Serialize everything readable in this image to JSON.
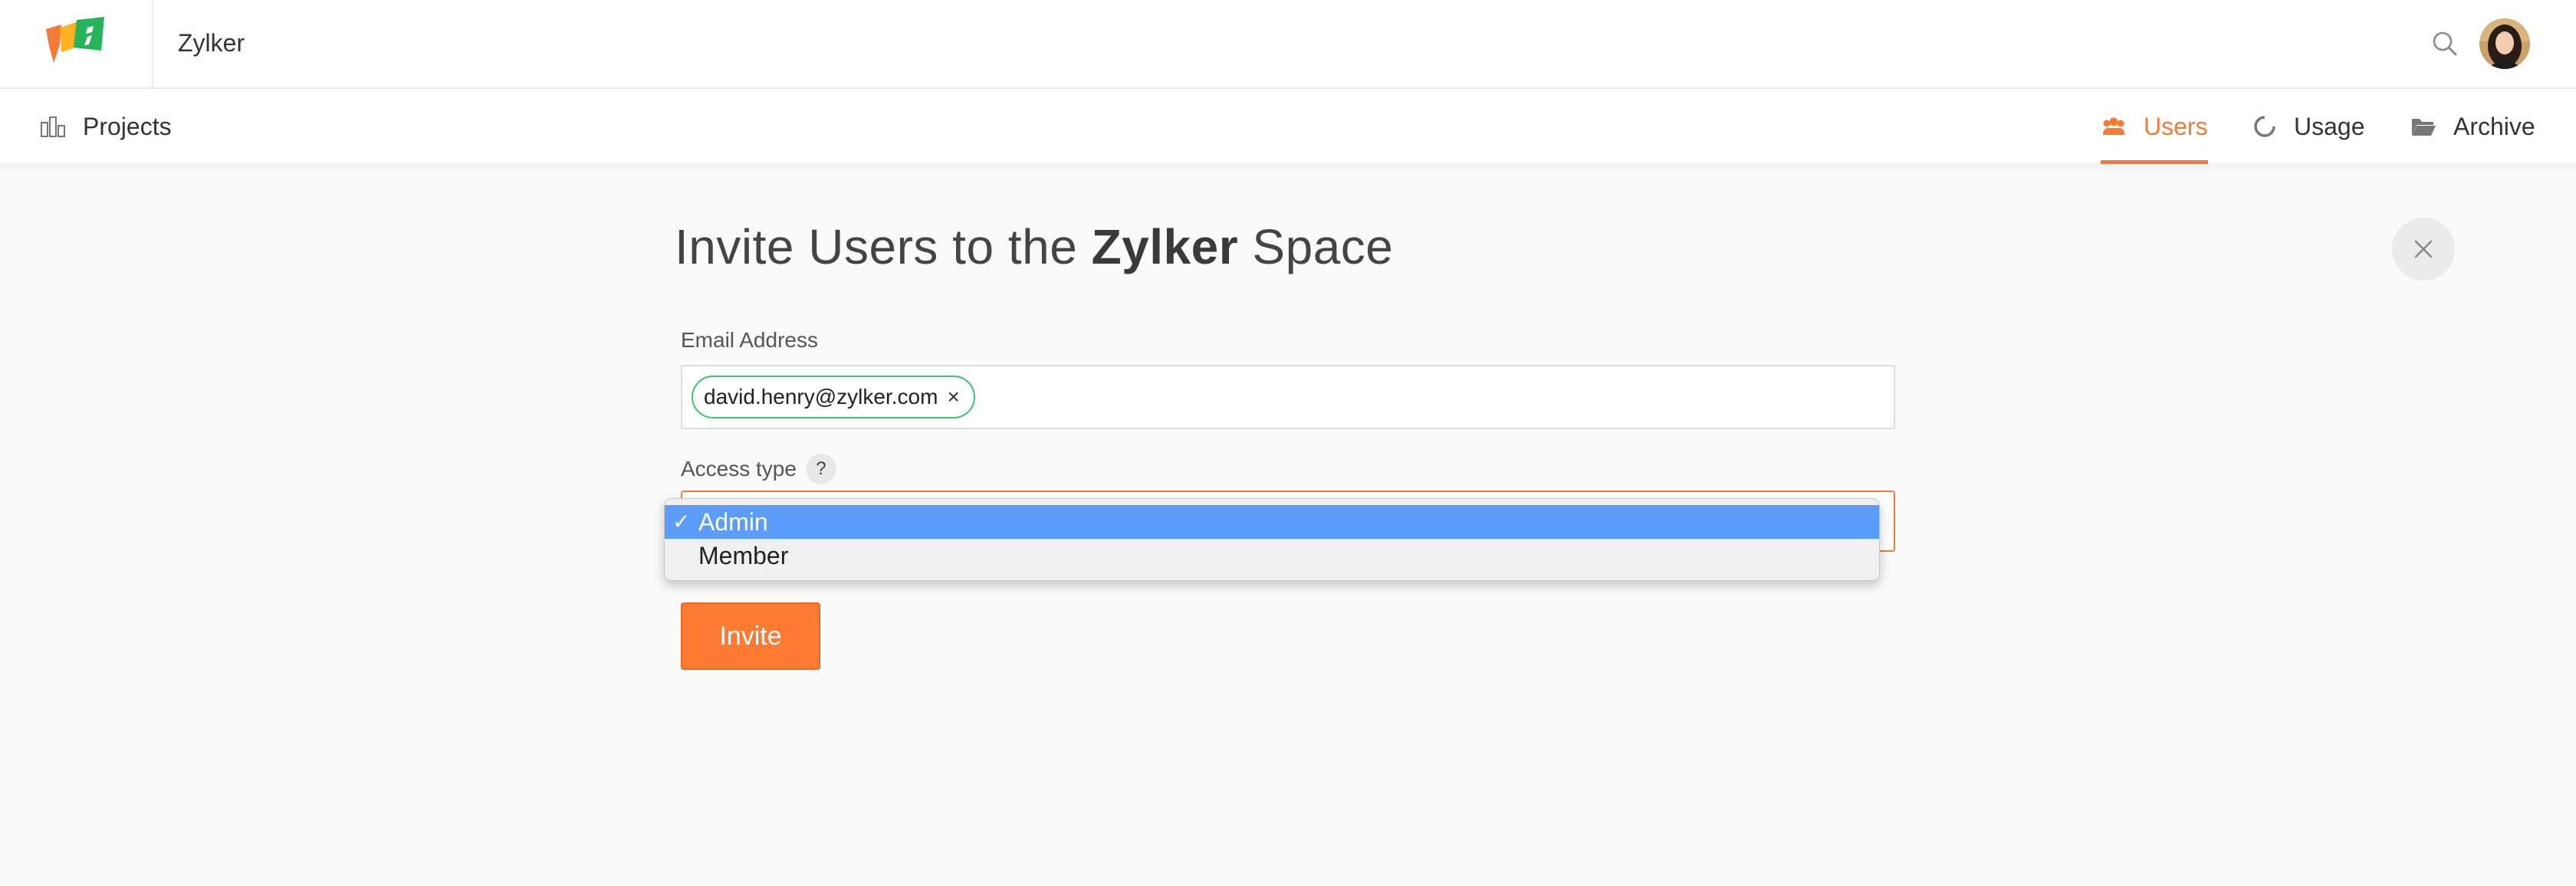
{
  "header": {
    "org_name": "Zylker",
    "logo_icon": "zylker-logo",
    "search_icon": "search-icon",
    "avatar_icon": "user-avatar"
  },
  "nav": {
    "projects": {
      "label": "Projects",
      "icon": "projects-icon"
    },
    "users": {
      "label": "Users",
      "icon": "users-icon",
      "active": true
    },
    "usage": {
      "label": "Usage",
      "icon": "usage-icon"
    },
    "archive": {
      "label": "Archive",
      "icon": "folder-icon"
    }
  },
  "page": {
    "title_prefix": "Invite Users to the ",
    "title_space": "Zylker",
    "title_suffix": " Space",
    "close_icon": "close-icon"
  },
  "form": {
    "email_label": "Email Address",
    "email_chips": [
      "david.henry@zylker.com"
    ],
    "chip_remove": "×",
    "access_label": "Access type",
    "help_text": "?",
    "access_options": [
      "Admin",
      "Member"
    ],
    "access_selected": "Admin",
    "check_mark": "✓",
    "invite_label": "Invite"
  },
  "colors": {
    "accent": "#f47a36",
    "button": "#ff7a33",
    "chip_border": "#3cc36e",
    "dropdown_highlight": "#5b9df8"
  }
}
